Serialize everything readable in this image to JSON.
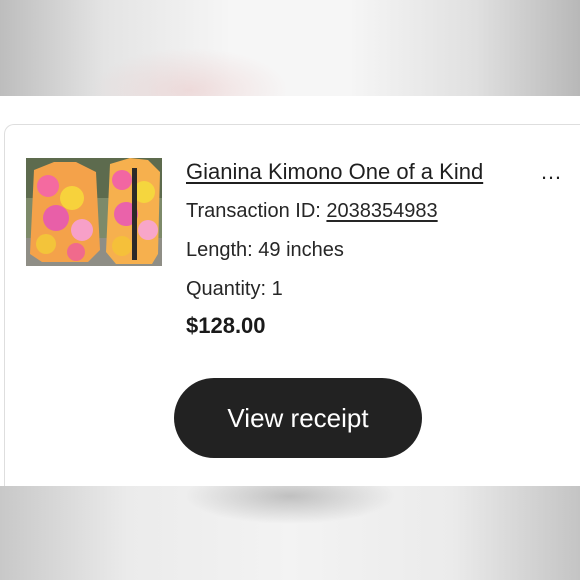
{
  "item": {
    "title": "Gianina Kimono One of a Kind",
    "ellipsis": "…",
    "transaction_label": "Transaction ID: ",
    "transaction_id": "2038354983",
    "length": "Length: 49 inches",
    "quantity": "Quantity: 1",
    "price": "$128.00",
    "image_icon": "kimono-product-photo"
  },
  "actions": {
    "view_receipt": "View receipt"
  },
  "colors": {
    "button_bg": "#222222",
    "button_text": "#ffffff",
    "text": "#1f1f1f"
  }
}
